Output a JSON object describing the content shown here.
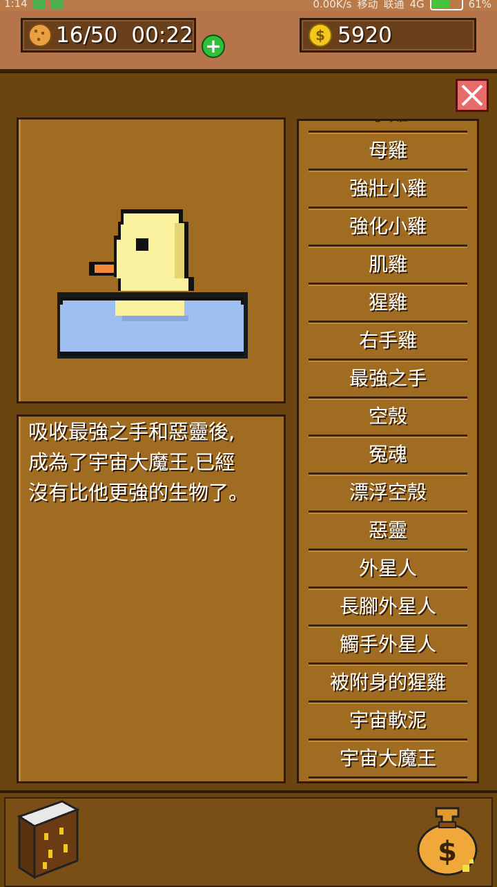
{
  "status_bar": {
    "time": "1:14",
    "net_speed": "0.00K/s",
    "carrier1": "移动",
    "carrier2": "联通",
    "network": "4G",
    "battery_level": "61%"
  },
  "hud": {
    "energy": "16/50",
    "timer": "00:22",
    "coins": "5920"
  },
  "colors": {
    "panel_bg": "#6b4510",
    "frame_bg": "#a06c22",
    "close_button": "#e86b6b",
    "plus_button": "#2fbf3a",
    "text": "#ffffff"
  },
  "detail": {
    "description_lines": "吸收最強之手和惡靈後,\n成為了宇宙大魔王,已經\n沒有比他更強的生物了。"
  },
  "creature_list": [
    "小雞",
    "母雞",
    "強壯小雞",
    "強化小雞",
    "肌雞",
    "猩雞",
    "右手雞",
    "最強之手",
    "空殼",
    "冤魂",
    "漂浮空殼",
    "惡靈",
    "外星人",
    "長腳外星人",
    "觸手外星人",
    "被附身的猩雞",
    "宇宙軟泥",
    "宇宙大魔王"
  ]
}
